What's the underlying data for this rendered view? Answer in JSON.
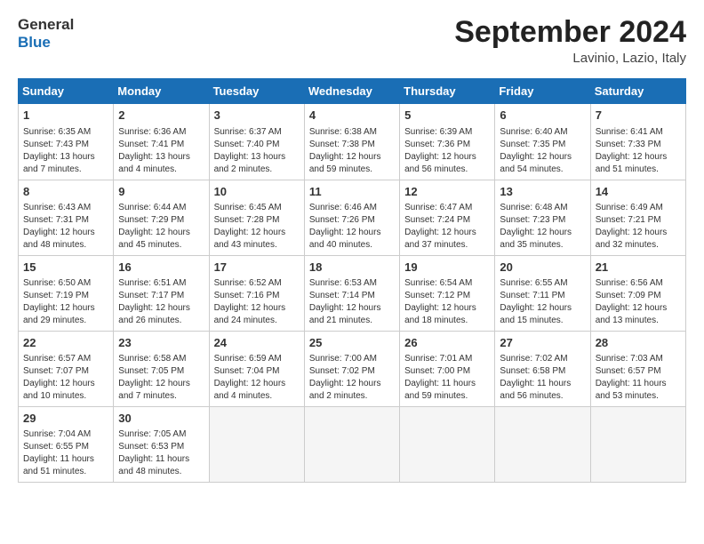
{
  "header": {
    "logo_line1": "General",
    "logo_line2": "Blue",
    "month": "September 2024",
    "location": "Lavinio, Lazio, Italy"
  },
  "weekdays": [
    "Sunday",
    "Monday",
    "Tuesday",
    "Wednesday",
    "Thursday",
    "Friday",
    "Saturday"
  ],
  "weeks": [
    [
      {
        "day": "1",
        "info": "Sunrise: 6:35 AM\nSunset: 7:43 PM\nDaylight: 13 hours\nand 7 minutes."
      },
      {
        "day": "2",
        "info": "Sunrise: 6:36 AM\nSunset: 7:41 PM\nDaylight: 13 hours\nand 4 minutes."
      },
      {
        "day": "3",
        "info": "Sunrise: 6:37 AM\nSunset: 7:40 PM\nDaylight: 13 hours\nand 2 minutes."
      },
      {
        "day": "4",
        "info": "Sunrise: 6:38 AM\nSunset: 7:38 PM\nDaylight: 12 hours\nand 59 minutes."
      },
      {
        "day": "5",
        "info": "Sunrise: 6:39 AM\nSunset: 7:36 PM\nDaylight: 12 hours\nand 56 minutes."
      },
      {
        "day": "6",
        "info": "Sunrise: 6:40 AM\nSunset: 7:35 PM\nDaylight: 12 hours\nand 54 minutes."
      },
      {
        "day": "7",
        "info": "Sunrise: 6:41 AM\nSunset: 7:33 PM\nDaylight: 12 hours\nand 51 minutes."
      }
    ],
    [
      {
        "day": "8",
        "info": "Sunrise: 6:43 AM\nSunset: 7:31 PM\nDaylight: 12 hours\nand 48 minutes."
      },
      {
        "day": "9",
        "info": "Sunrise: 6:44 AM\nSunset: 7:29 PM\nDaylight: 12 hours\nand 45 minutes."
      },
      {
        "day": "10",
        "info": "Sunrise: 6:45 AM\nSunset: 7:28 PM\nDaylight: 12 hours\nand 43 minutes."
      },
      {
        "day": "11",
        "info": "Sunrise: 6:46 AM\nSunset: 7:26 PM\nDaylight: 12 hours\nand 40 minutes."
      },
      {
        "day": "12",
        "info": "Sunrise: 6:47 AM\nSunset: 7:24 PM\nDaylight: 12 hours\nand 37 minutes."
      },
      {
        "day": "13",
        "info": "Sunrise: 6:48 AM\nSunset: 7:23 PM\nDaylight: 12 hours\nand 35 minutes."
      },
      {
        "day": "14",
        "info": "Sunrise: 6:49 AM\nSunset: 7:21 PM\nDaylight: 12 hours\nand 32 minutes."
      }
    ],
    [
      {
        "day": "15",
        "info": "Sunrise: 6:50 AM\nSunset: 7:19 PM\nDaylight: 12 hours\nand 29 minutes."
      },
      {
        "day": "16",
        "info": "Sunrise: 6:51 AM\nSunset: 7:17 PM\nDaylight: 12 hours\nand 26 minutes."
      },
      {
        "day": "17",
        "info": "Sunrise: 6:52 AM\nSunset: 7:16 PM\nDaylight: 12 hours\nand 24 minutes."
      },
      {
        "day": "18",
        "info": "Sunrise: 6:53 AM\nSunset: 7:14 PM\nDaylight: 12 hours\nand 21 minutes."
      },
      {
        "day": "19",
        "info": "Sunrise: 6:54 AM\nSunset: 7:12 PM\nDaylight: 12 hours\nand 18 minutes."
      },
      {
        "day": "20",
        "info": "Sunrise: 6:55 AM\nSunset: 7:11 PM\nDaylight: 12 hours\nand 15 minutes."
      },
      {
        "day": "21",
        "info": "Sunrise: 6:56 AM\nSunset: 7:09 PM\nDaylight: 12 hours\nand 13 minutes."
      }
    ],
    [
      {
        "day": "22",
        "info": "Sunrise: 6:57 AM\nSunset: 7:07 PM\nDaylight: 12 hours\nand 10 minutes."
      },
      {
        "day": "23",
        "info": "Sunrise: 6:58 AM\nSunset: 7:05 PM\nDaylight: 12 hours\nand 7 minutes."
      },
      {
        "day": "24",
        "info": "Sunrise: 6:59 AM\nSunset: 7:04 PM\nDaylight: 12 hours\nand 4 minutes."
      },
      {
        "day": "25",
        "info": "Sunrise: 7:00 AM\nSunset: 7:02 PM\nDaylight: 12 hours\nand 2 minutes."
      },
      {
        "day": "26",
        "info": "Sunrise: 7:01 AM\nSunset: 7:00 PM\nDaylight: 11 hours\nand 59 minutes."
      },
      {
        "day": "27",
        "info": "Sunrise: 7:02 AM\nSunset: 6:58 PM\nDaylight: 11 hours\nand 56 minutes."
      },
      {
        "day": "28",
        "info": "Sunrise: 7:03 AM\nSunset: 6:57 PM\nDaylight: 11 hours\nand 53 minutes."
      }
    ],
    [
      {
        "day": "29",
        "info": "Sunrise: 7:04 AM\nSunset: 6:55 PM\nDaylight: 11 hours\nand 51 minutes."
      },
      {
        "day": "30",
        "info": "Sunrise: 7:05 AM\nSunset: 6:53 PM\nDaylight: 11 hours\nand 48 minutes."
      },
      {
        "day": "",
        "info": ""
      },
      {
        "day": "",
        "info": ""
      },
      {
        "day": "",
        "info": ""
      },
      {
        "day": "",
        "info": ""
      },
      {
        "day": "",
        "info": ""
      }
    ]
  ]
}
